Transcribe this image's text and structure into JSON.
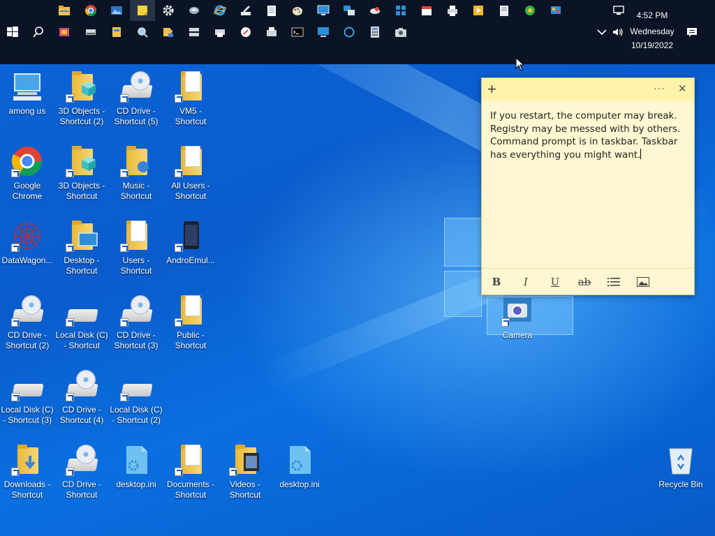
{
  "taskbar": {
    "clock_time": "4:52 PM",
    "clock_day": "Wednesday",
    "clock_date": "10/19/2022",
    "top_row_icons": [
      "file-explorer-icon",
      "chrome-icon",
      "photos-icon",
      "sticky-notes-icon",
      "settings-icon",
      "network-icon",
      "internet-explorer-icon",
      "pen-icon",
      "notepad-icon",
      "paint-icon",
      "display-icon",
      "remote-icon",
      "weather-icon",
      "store-icon",
      "calendar-icon",
      "printer-icon",
      "media-player-icon",
      "document-icon",
      "media-center-icon",
      "control-panel-icon"
    ],
    "bottom_row_icons": [
      "start-icon",
      "search-icon",
      "paint-shop-icon",
      "drive-icon",
      "registry-icon",
      "magnifier-icon",
      "users-icon",
      "server-icon",
      "printer-alt-icon",
      "compass-icon",
      "fax-icon",
      "command-prompt-icon",
      "monitor-icon",
      "cortana-icon",
      "calculator-icon",
      "camera-icon"
    ],
    "tray_icons": [
      "network-tray-icon",
      "chevron-up-icon",
      "volume-icon",
      "action-center-icon"
    ]
  },
  "desktop_icons": [
    {
      "label": "among us",
      "kind": "pc"
    },
    {
      "label": "3D Objects - Shortcut (2)",
      "kind": "folder3d"
    },
    {
      "label": "CD Drive - Shortcut (5)",
      "kind": "cd"
    },
    {
      "label": "VM5 - Shortcut",
      "kind": "folder"
    },
    {
      "label": "Google Chrome",
      "kind": "chrome"
    },
    {
      "label": "3D Objects - Shortcut",
      "kind": "folder3d"
    },
    {
      "label": "Music - Shortcut",
      "kind": "folder"
    },
    {
      "label": "All Users - Shortcut",
      "kind": "folder"
    },
    {
      "label": "DataWagon...",
      "kind": "data"
    },
    {
      "label": "Desktop - Shortcut",
      "kind": "folder"
    },
    {
      "label": "Users - Shortcut",
      "kind": "folder"
    },
    {
      "label": "AndroEmul...",
      "kind": "phone"
    },
    {
      "label": "CD Drive - Shortcut (2)",
      "kind": "cd"
    },
    {
      "label": "Local Disk (C) - Shortcut",
      "kind": "disk"
    },
    {
      "label": "CD Drive - Shortcut (3)",
      "kind": "cd"
    },
    {
      "label": "Public - Shortcut",
      "kind": "folder"
    },
    {
      "label": "Local Disk (C) - Shortcut (3)",
      "kind": "disk"
    },
    {
      "label": "CD Drive - Shortcut (4)",
      "kind": "cd"
    },
    {
      "label": "Local Disk (C) - Shortcut (2)",
      "kind": "disk"
    },
    {
      "label": "Downloads - Shortcut",
      "kind": "folder"
    },
    {
      "label": "CD Drive - Shortcut",
      "kind": "cd"
    },
    {
      "label": "desktop.ini",
      "kind": "ini"
    },
    {
      "label": "Documents - Shortcut",
      "kind": "folder"
    },
    {
      "label": "Videos - Shortcut",
      "kind": "folder"
    },
    {
      "label": "desktop.ini",
      "kind": "ini"
    },
    {
      "label": "Camera",
      "kind": "camera"
    },
    {
      "label": "Recycle Bin",
      "kind": "recycle"
    }
  ],
  "sticky_note": {
    "text": "If you restart, the computer may break. Registry may be messed with by others. Command prompt is in taskbar. Taskbar has everything you might want.",
    "add_label": "+",
    "menu_label": "···",
    "close_label": "✕",
    "format_buttons": [
      "B",
      "I",
      "U",
      "ab",
      "list",
      "image"
    ]
  },
  "colors": {
    "taskbar": "#0b1424",
    "sticky_bg": "#fff7d1",
    "sticky_header": "#fff2ab",
    "desktop_blue": "#0a5ed0"
  }
}
